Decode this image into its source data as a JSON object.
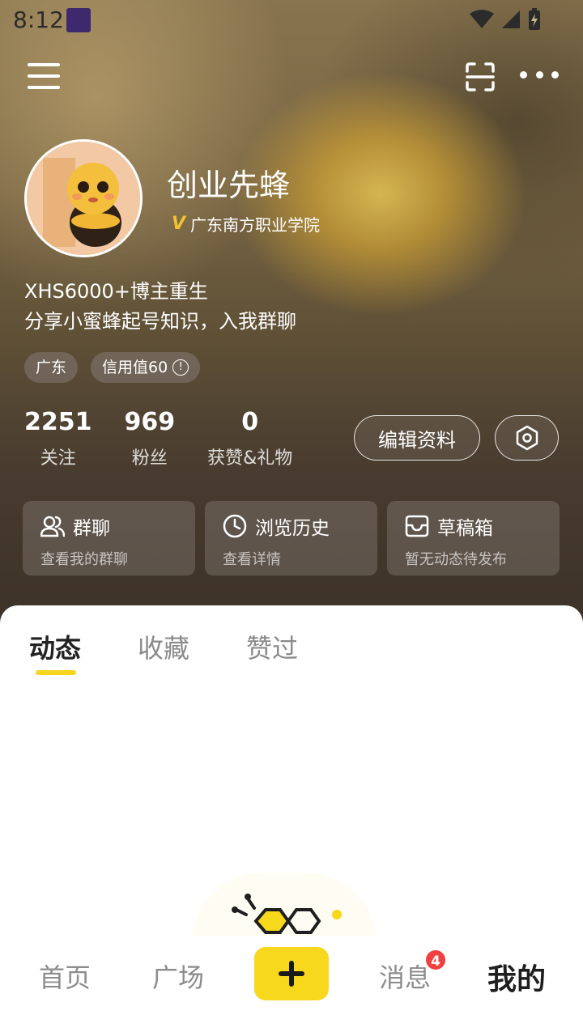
{
  "status_bar": {
    "time": "8:12"
  },
  "profile": {
    "nickname": "创业先蜂",
    "school": "广东南方职业学院",
    "bio_line1": "XHS6000+博主重生",
    "bio_line2": "分享小蜜蜂起号知识，入我群聊",
    "tags": [
      "广东",
      "信用值60"
    ]
  },
  "stats": [
    {
      "value": "2251",
      "label": "关注"
    },
    {
      "value": "969",
      "label": "粉丝"
    },
    {
      "value": "0",
      "label": "获赞&礼物"
    }
  ],
  "actions": {
    "edit_label": "编辑资料"
  },
  "cards": [
    {
      "title": "群聊",
      "subtitle": "查看我的群聊",
      "icon": "group-icon"
    },
    {
      "title": "浏览历史",
      "subtitle": "查看详情",
      "icon": "clock-icon"
    },
    {
      "title": "草稿箱",
      "subtitle": "暂无动态待发布",
      "icon": "inbox-icon"
    }
  ],
  "tabs": [
    "动态",
    "收藏",
    "赞过"
  ],
  "active_tab": "动态",
  "bottom_nav": {
    "items": [
      "首页",
      "广场",
      "消息",
      "我的"
    ],
    "active": "我的",
    "message_badge": "4"
  },
  "colors": {
    "accent": "#f8d81c",
    "badge": "#f04040"
  }
}
